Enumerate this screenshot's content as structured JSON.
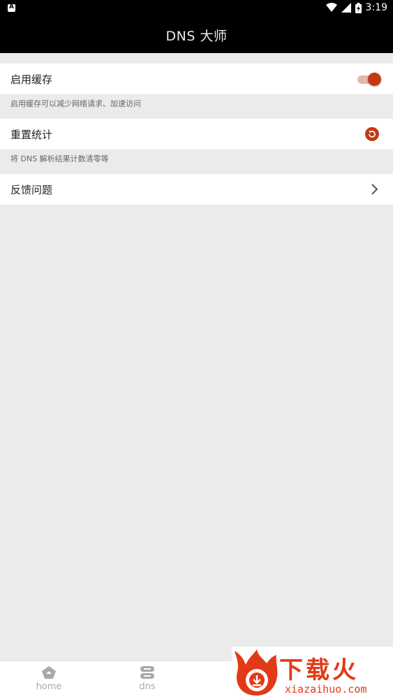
{
  "status_bar": {
    "left_badge": "A",
    "time": "3:19",
    "icons": [
      "wifi-icon",
      "signal-icon",
      "battery-icon"
    ]
  },
  "app_bar": {
    "title": "DNS 大师"
  },
  "settings": {
    "cache": {
      "label": "启用缓存",
      "enabled": true,
      "description": "启用缓存可以减少网络请求、加速访问"
    },
    "reset": {
      "label": "重置统计",
      "description": "将 DNS 解析结果计数清零等"
    },
    "feedback": {
      "label": "反馈问题"
    }
  },
  "bottom_nav": {
    "items": [
      {
        "label": "home",
        "icon": "home-icon"
      },
      {
        "label": "dns",
        "icon": "dns-server-icon"
      }
    ]
  },
  "watermark": {
    "title": "下载火",
    "url": "xiazaihuo.com"
  },
  "colors": {
    "accent": "#c23a12",
    "toggle_track": "#eab4a8",
    "app_bar": "#000000",
    "background": "#ebebeb",
    "watermark": "#e23a16"
  }
}
